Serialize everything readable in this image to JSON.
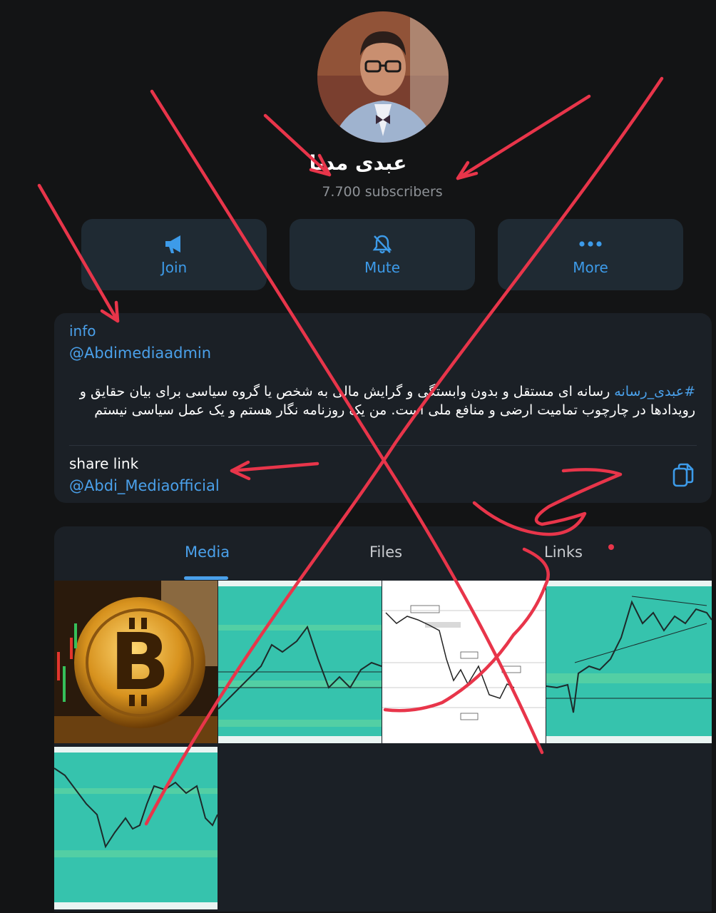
{
  "channel": {
    "name": "عبدی مدیا",
    "subscribers": "7.700 subscribers"
  },
  "actions": {
    "join": "Join",
    "mute": "Mute",
    "more": "More"
  },
  "info": {
    "label": "info",
    "admin": "@Abdimediaadmin",
    "hashtag": "#عبدی_رسانه",
    "description": " رسانه ای مستقل و بدون وابستگی و گرایش مالی به شخص یا گروه سیاسی برای بیان حقایق و رویدادها در چارچوب تمامیت ارضی و منافع ملی است.  من یک روزنامه نگار هستم و یک عمل سیاسی نیستم",
    "share_label": "share link",
    "share_link": "@Abdi_Mediaofficial"
  },
  "tabs": [
    "Media",
    "Files",
    "Links"
  ],
  "colors": {
    "accent": "#4aa0ea",
    "background": "#131415",
    "card": "#1b2026",
    "annotation": "#e8354a",
    "chart_bg": "#36c3ad"
  }
}
